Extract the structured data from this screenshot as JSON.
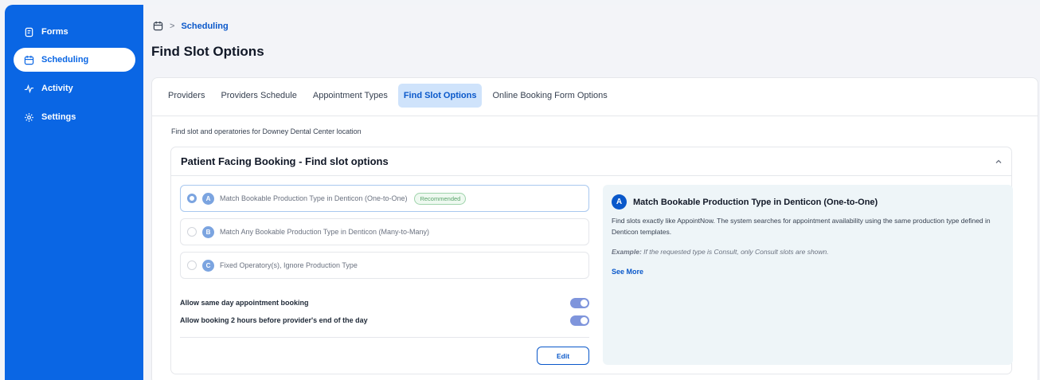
{
  "sidebar": {
    "items": [
      {
        "label": "Forms",
        "icon": "form-icon",
        "active": false
      },
      {
        "label": "Scheduling",
        "icon": "calendar-icon",
        "active": true
      },
      {
        "label": "Activity",
        "icon": "activity-icon",
        "active": false
      },
      {
        "label": "Settings",
        "icon": "gear-icon",
        "active": false
      }
    ]
  },
  "breadcrumb": {
    "icon": "calendar-icon",
    "separator": ">",
    "current": "Scheduling"
  },
  "page": {
    "title": "Find Slot Options"
  },
  "tabs": [
    {
      "label": "Providers",
      "active": false
    },
    {
      "label": "Providers Schedule",
      "active": false
    },
    {
      "label": "Appointment Types",
      "active": false
    },
    {
      "label": "Find Slot Options",
      "active": true
    },
    {
      "label": "Online Booking Form Options",
      "active": false
    }
  ],
  "location_text": "Find slot and operatories for Downey Dental Center location",
  "panel": {
    "title": "Patient Facing Booking - Find slot options",
    "options": [
      {
        "letter": "A",
        "label": "Match Bookable Production Type in Denticon (One-to-One)",
        "badge": "Recommended",
        "selected": true
      },
      {
        "letter": "B",
        "label": "Match Any Bookable Production Type in Denticon (Many-to-Many)",
        "badge": "",
        "selected": false
      },
      {
        "letter": "C",
        "label": "Fixed Operatory(s), Ignore Production Type",
        "badge": "",
        "selected": false
      }
    ],
    "toggles": [
      {
        "label": "Allow same day appointment booking",
        "on": true
      },
      {
        "label": "Allow booking 2 hours before provider's end of the day",
        "on": true
      }
    ],
    "edit_label": "Edit",
    "info": {
      "letter": "A",
      "title": "Match Bookable Production Type in Denticon (One-to-One)",
      "description": "Find slots exactly like AppointNow. The system searches for appointment availability using the same production type defined in Denticon templates.",
      "example_label": "Example:",
      "example_text": "If the requested type is Consult, only Consult slots are shown.",
      "see_more": "See More"
    }
  },
  "colors": {
    "sidebar": "#0a66e4",
    "accent": "#0a58ca",
    "tab_active_bg": "#cfe3fb",
    "info_bg": "#eef5f8"
  }
}
